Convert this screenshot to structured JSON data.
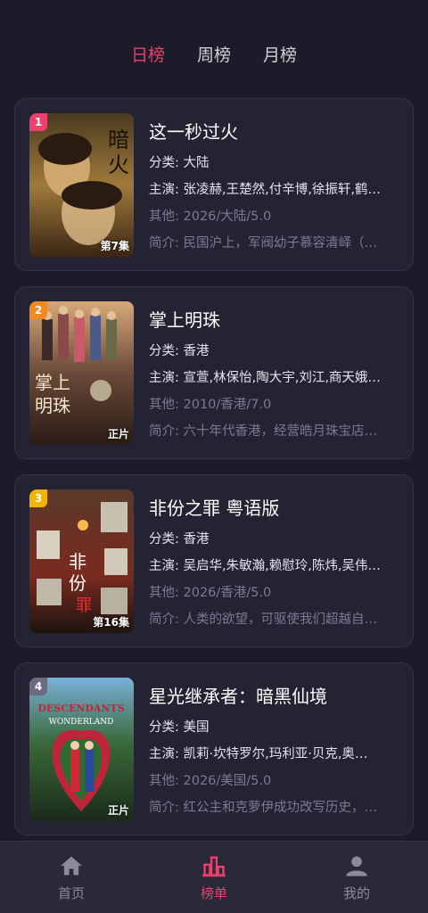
{
  "tabs": [
    {
      "label": "日榜",
      "active": true
    },
    {
      "label": "周榜",
      "active": false
    },
    {
      "label": "月榜",
      "active": false
    }
  ],
  "items": [
    {
      "rank": "1",
      "badge_color": "#ee3f6e",
      "episode": "第7集",
      "poster_text": "暗火",
      "title": "这一秒过火",
      "category": "分类: 大陆",
      "cast": "主演: 张凌赫,王楚然,付辛博,徐振轩,鹤…",
      "other": "其他: 2026/大陆/5.0",
      "summary": "简介: 民国沪上，军阀幼子慕容清峄（…"
    },
    {
      "rank": "2",
      "badge_color": "#f08a24",
      "episode": "正片",
      "poster_text": "掌上明珠",
      "title": "掌上明珠",
      "category": "分类: 香港",
      "cast": "主演: 宣萱,林保怡,陶大宇,刘江,商天娥…",
      "other": "其他: 2010/香港/7.0",
      "summary": "简介: 六十年代香港，经营皓月珠宝店…"
    },
    {
      "rank": "3",
      "badge_color": "#f2b400",
      "episode": "第16集",
      "poster_text": "非份之罪",
      "title": "非份之罪 粤语版",
      "category": "分类: 香港",
      "cast": "主演: 吴启华,朱敏瀚,赖慰玲,陈炜,吴伟…",
      "other": "其他: 2026/香港/5.0",
      "summary": "简介: 人类的欲望，可驱使我们超越自…"
    },
    {
      "rank": "4",
      "badge_color": "#6b6a80",
      "episode": "正片",
      "poster_text": "DESCENDANTS WONDERLAND",
      "title": "星光继承者：暗黑仙境",
      "category": "分类: 美国",
      "cast": "主演: 凯莉·坎特罗尔,玛利亚·贝克,奥…",
      "other": "其他: 2026/美国/5.0",
      "summary": "简介: 红公主和克萝伊成功改写历史，…"
    }
  ],
  "nav": [
    {
      "label": "首页",
      "icon": "home-icon",
      "active": false
    },
    {
      "label": "榜单",
      "icon": "chart-icon",
      "active": true
    },
    {
      "label": "我的",
      "icon": "user-icon",
      "active": false
    }
  ]
}
